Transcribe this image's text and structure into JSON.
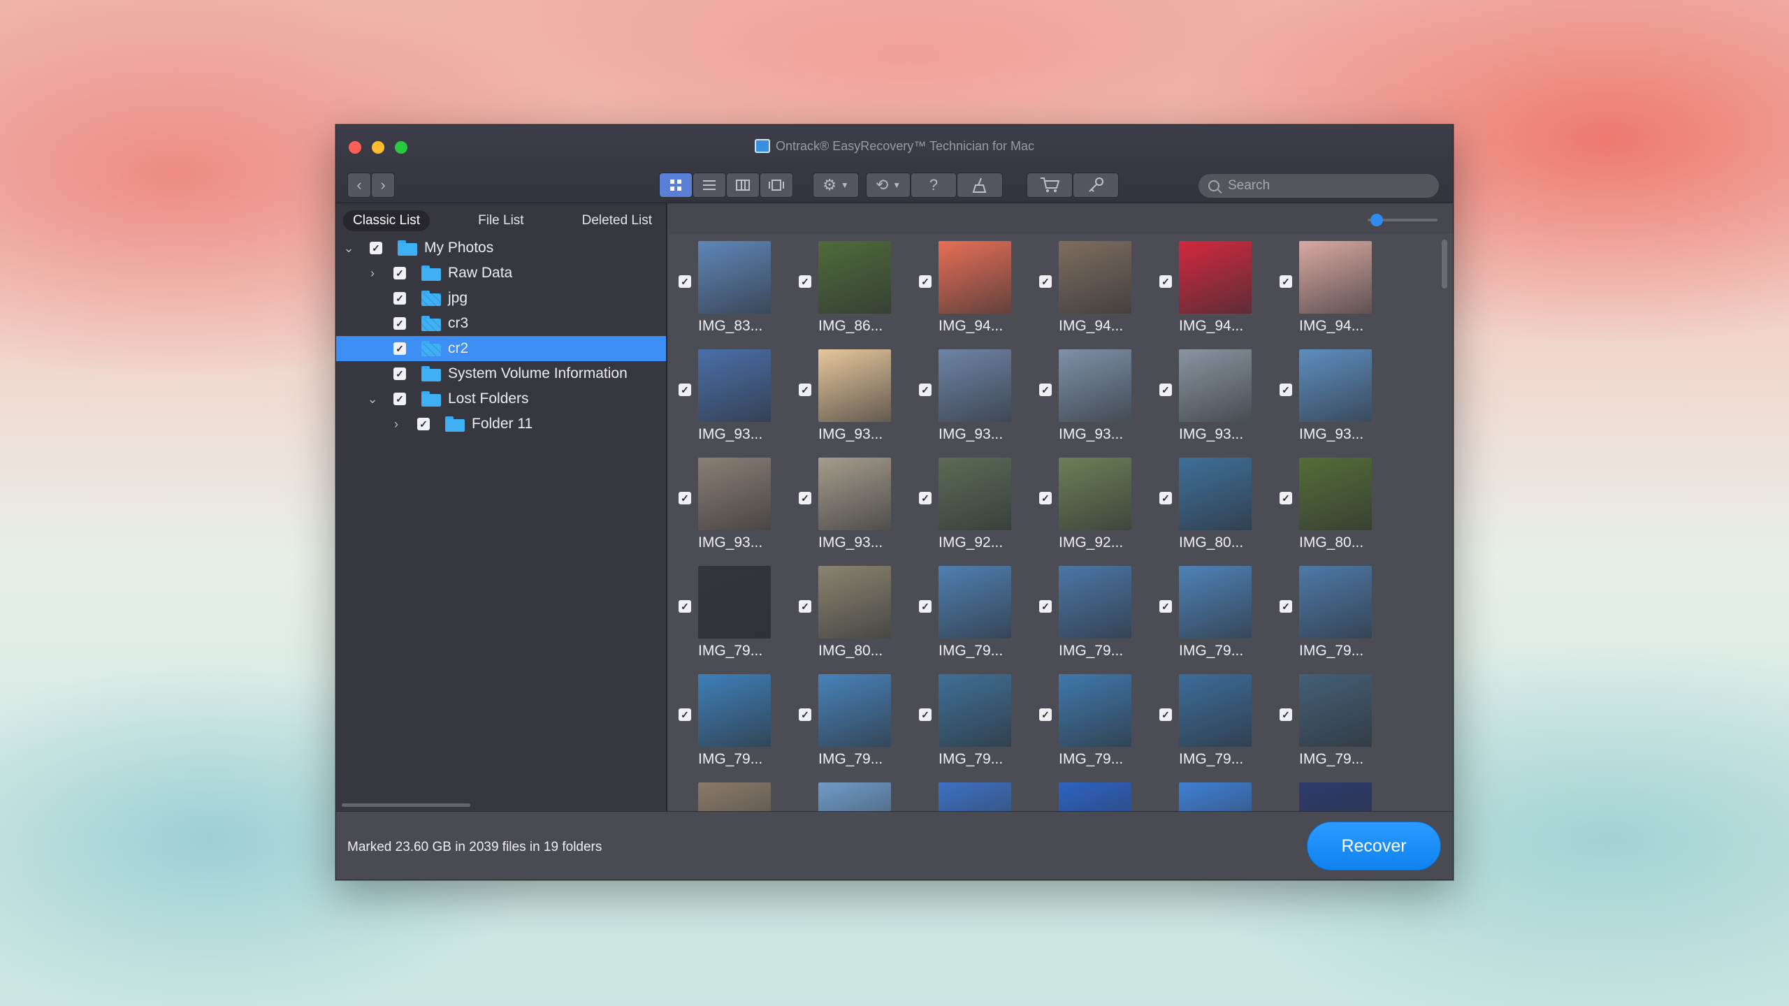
{
  "window": {
    "title": "Ontrack® EasyRecovery™ Technician for Mac"
  },
  "toolbar": {
    "back_icon": "‹",
    "forward_icon": "›",
    "views": [
      "grid-view-icon",
      "list-view-icon",
      "columns-view-icon",
      "filmstrip-view-icon"
    ],
    "gear_icon": "⚙",
    "history_icon": "⟲",
    "help_icon": "?",
    "cleanup_icon": "⎍",
    "cart_icon": "🛒",
    "key_icon": "🔑",
    "search_placeholder": "Search"
  },
  "sidebar": {
    "tabs": [
      "Classic List",
      "File List",
      "Deleted List"
    ],
    "selected_tab": "Classic List",
    "tree": [
      {
        "label": "My Photos",
        "level": 0,
        "expanded": true,
        "checked": true,
        "icon": "folder"
      },
      {
        "label": "Raw Data",
        "level": 1,
        "expanded": false,
        "checked": true,
        "icon": "folder"
      },
      {
        "label": "jpg",
        "level": 1,
        "checked": true,
        "icon": "folder-deleted"
      },
      {
        "label": "cr3",
        "level": 1,
        "checked": true,
        "icon": "folder-deleted"
      },
      {
        "label": "cr2",
        "level": 1,
        "checked": true,
        "icon": "folder-deleted",
        "selected": true
      },
      {
        "label": "System Volume Information",
        "level": 1,
        "checked": true,
        "icon": "folder"
      },
      {
        "label": "Lost Folders",
        "level": 1,
        "expanded": true,
        "checked": true,
        "icon": "folder"
      },
      {
        "label": "Folder 11",
        "level": 2,
        "expanded": false,
        "checked": true,
        "icon": "folder"
      }
    ]
  },
  "grid": {
    "items": [
      {
        "name": "IMG_83...",
        "color": "#5f86b8"
      },
      {
        "name": "IMG_86...",
        "color": "#4f6b3a"
      },
      {
        "name": "IMG_94...",
        "color": "#e76f56"
      },
      {
        "name": "IMG_94...",
        "color": "#7d6d5f"
      },
      {
        "name": "IMG_94...",
        "color": "#d3283f"
      },
      {
        "name": "IMG_94...",
        "color": "#d9a9a2"
      },
      {
        "name": "IMG_93...",
        "color": "#4a6fa8"
      },
      {
        "name": "IMG_93...",
        "color": "#e7c79b"
      },
      {
        "name": "IMG_93...",
        "color": "#6e84a6"
      },
      {
        "name": "IMG_93...",
        "color": "#7e91a8"
      },
      {
        "name": "IMG_93...",
        "color": "#8a95a0"
      },
      {
        "name": "IMG_93...",
        "color": "#5d8ec0"
      },
      {
        "name": "IMG_93...",
        "color": "#8b7f74"
      },
      {
        "name": "IMG_93...",
        "color": "#a59c8c"
      },
      {
        "name": "IMG_92...",
        "color": "#5b6b55"
      },
      {
        "name": "IMG_92...",
        "color": "#6c7f57"
      },
      {
        "name": "IMG_80...",
        "color": "#3e6f99"
      },
      {
        "name": "IMG_80...",
        "color": "#556d37"
      },
      {
        "name": "IMG_79...",
        "color": "#33363c"
      },
      {
        "name": "IMG_80...",
        "color": "#8a8470"
      },
      {
        "name": "IMG_79...",
        "color": "#4f7fb1"
      },
      {
        "name": "IMG_79...",
        "color": "#4b76a6"
      },
      {
        "name": "IMG_79...",
        "color": "#4e82b7"
      },
      {
        "name": "IMG_79...",
        "color": "#4d79a8"
      },
      {
        "name": "IMG_79...",
        "color": "#3e7fb8"
      },
      {
        "name": "IMG_79...",
        "color": "#4782ba"
      },
      {
        "name": "IMG_79...",
        "color": "#3f6f96"
      },
      {
        "name": "IMG_79...",
        "color": "#3f78ac"
      },
      {
        "name": "IMG_79...",
        "color": "#3c6c9a"
      },
      {
        "name": "IMG_79...",
        "color": "#445f76"
      },
      {
        "name": "",
        "color": "#8a7b6a"
      },
      {
        "name": "",
        "color": "#6f9bc8"
      },
      {
        "name": "",
        "color": "#3d71c2"
      },
      {
        "name": "",
        "color": "#2d63c4"
      },
      {
        "name": "",
        "color": "#3f7fd3"
      },
      {
        "name": "",
        "color": "#2d3b6d"
      }
    ]
  },
  "footer": {
    "status": "Marked 23.60 GB in 2039 files in 19 folders",
    "recover_label": "Recover"
  },
  "colors": {
    "accent": "#3d8ef5",
    "recover": "#1a8df7"
  }
}
